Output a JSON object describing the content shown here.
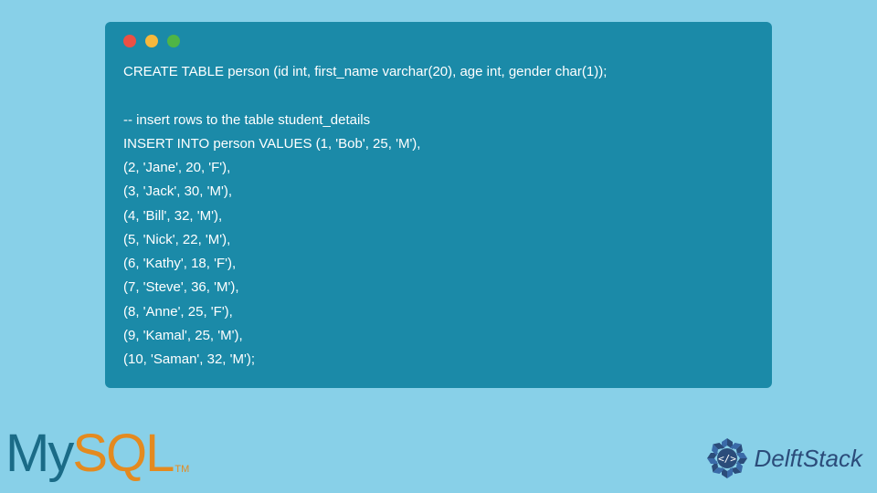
{
  "code": {
    "lines": "CREATE TABLE person (id int, first_name varchar(20), age int, gender char(1));\n\n-- insert rows to the table student_details\nINSERT INTO person VALUES (1, 'Bob', 25, 'M'),\n(2, 'Jane', 20, 'F'),\n(3, 'Jack', 30, 'M'),\n(4, 'Bill', 32, 'M'),\n(5, 'Nick', 22, 'M'),\n(6, 'Kathy', 18, 'F'),\n(7, 'Steve', 36, 'M'),\n(8, 'Anne', 25, 'F'),\n(9, 'Kamal', 25, 'M'),\n(10, 'Saman', 32, 'M');"
  },
  "logos": {
    "mysql_my": "My",
    "mysql_sql": "SQL",
    "mysql_tm": "TM",
    "delftstack": "DelftStack",
    "ds_code": "</>"
  }
}
